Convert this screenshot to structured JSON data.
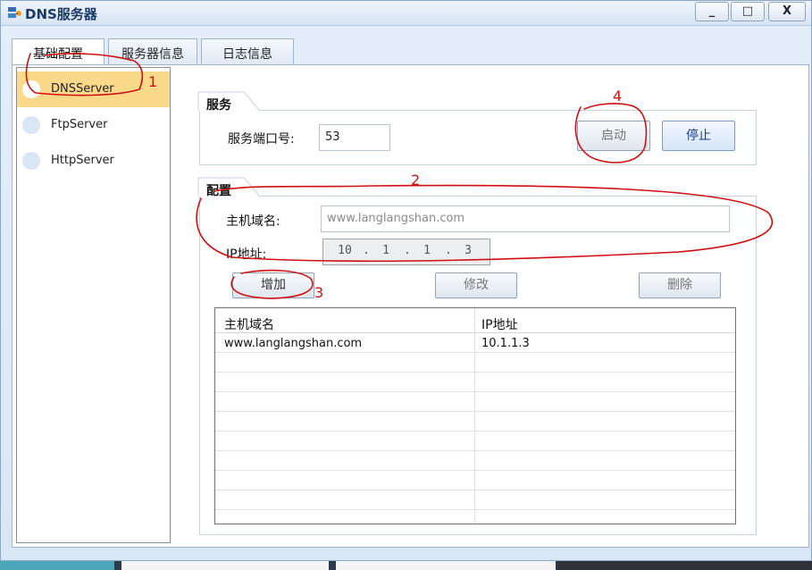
{
  "window": {
    "title": "DNS服务器",
    "min_glyph": "_",
    "max_glyph": "□",
    "close_glyph": "X"
  },
  "tabs": [
    {
      "label": "基础配置",
      "active": true
    },
    {
      "label": "服务器信息",
      "active": false
    },
    {
      "label": "日志信息",
      "active": false
    }
  ],
  "sidebar": {
    "items": [
      {
        "label": "DNSServer",
        "selected": true
      },
      {
        "label": "FtpServer",
        "selected": false
      },
      {
        "label": "HttpServer",
        "selected": false
      }
    ]
  },
  "service": {
    "group_title": "服务",
    "port_label": "服务端口号:",
    "port_value": "53",
    "start_label": "启动",
    "stop_label": "停止"
  },
  "config": {
    "group_title": "配置",
    "domain_label": "主机域名:",
    "domain_value": "www.langlangshan.com",
    "ip_label": "IP地址:",
    "ip_octets": [
      "10",
      "1",
      "1",
      "3"
    ],
    "ip_sep": ".",
    "add_label": "增加",
    "modify_label": "修改",
    "delete_label": "删除"
  },
  "table": {
    "headers": [
      "主机域名",
      "IP地址"
    ],
    "rows": [
      [
        "www.langlangshan.com",
        "10.1.1.3"
      ]
    ]
  },
  "annotations": {
    "color": "#d01010",
    "numbers": [
      "1",
      "2",
      "3",
      "4"
    ]
  },
  "colors": {
    "selected_item": "#fbd98b",
    "accent": "#1b3f8a"
  }
}
